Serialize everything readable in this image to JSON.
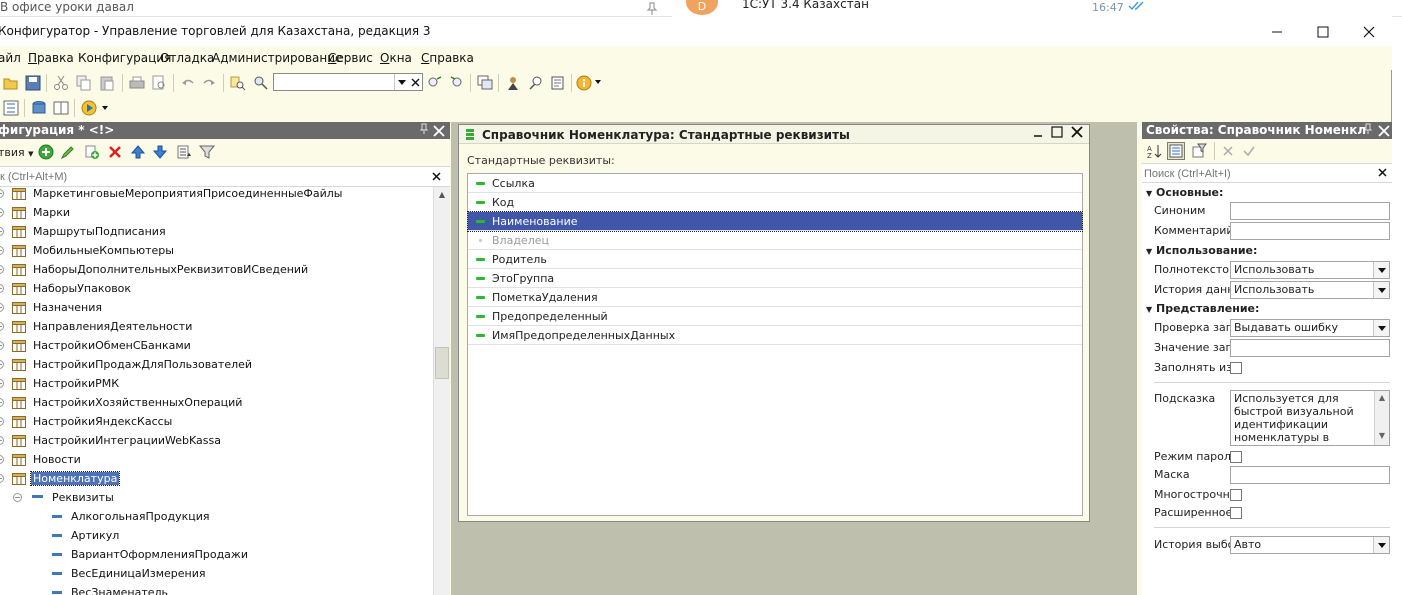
{
  "chat": {
    "title": "В офисе уроки давал",
    "avatar_letter": "D",
    "notification_text": "1С:УТ 3.4 Казахстан",
    "time": "16:47"
  },
  "window": {
    "title": "Конфигуратор - Управление торговлей для Казахстана, редакция 3"
  },
  "menu": [
    {
      "label": "айл"
    },
    {
      "label": "Правка",
      "underline": "П",
      "rest": "равка"
    },
    {
      "label": "Конфигурация"
    },
    {
      "label": "Отладка"
    },
    {
      "label": "Администрирование"
    },
    {
      "label": "Сервис",
      "underline": "С",
      "rest": "ервис"
    },
    {
      "label": "Окна",
      "underline": "О",
      "rest": "кна"
    },
    {
      "label": "Справка",
      "underline": "С",
      "rest": "правка"
    }
  ],
  "toolbar": {
    "search_value": ""
  },
  "config_panel": {
    "title": "фигурация * <!>",
    "actions_label": "твия",
    "search_placeholder": "к (Ctrl+Alt+M)",
    "tree": [
      {
        "label": "МаркетинговыеМероприятияПрисоединенныеФайлы",
        "level": 0
      },
      {
        "label": "Марки",
        "level": 0
      },
      {
        "label": "МаршрутыПодписания",
        "level": 0
      },
      {
        "label": "МобильныеКомпьютеры",
        "level": 0
      },
      {
        "label": "НаборыДополнительныхРеквизитовИСведений",
        "level": 0
      },
      {
        "label": "НаборыУпаковок",
        "level": 0
      },
      {
        "label": "Назначения",
        "level": 0
      },
      {
        "label": "НаправленияДеятельности",
        "level": 0
      },
      {
        "label": "НастройкиОбменСБанками",
        "level": 0
      },
      {
        "label": "НастройкиПродажДляПользователей",
        "level": 0
      },
      {
        "label": "НастройкиРМК",
        "level": 0
      },
      {
        "label": "НастройкиХозяйственныхОпераций",
        "level": 0
      },
      {
        "label": "НастройкиЯндексКассы",
        "level": 0
      },
      {
        "label": "НастройкиИнтеграцииWebKassa",
        "level": 0
      },
      {
        "label": "Новости",
        "level": 0
      },
      {
        "label": "Номенклатура",
        "level": 0,
        "selected": true
      },
      {
        "label": "Реквизиты",
        "level": 1
      },
      {
        "label": "АлкогольнаяПродукция",
        "level": 2
      },
      {
        "label": "Артикул",
        "level": 2
      },
      {
        "label": "ВариантОформленияПродажи",
        "level": 2
      },
      {
        "label": "ВесЕдиницаИзмерения",
        "level": 2
      },
      {
        "label": "ВесЗнаменатель",
        "level": 2
      }
    ]
  },
  "dialog": {
    "title": "Справочник Номенклатура: Стандартные реквизиты",
    "label": "Стандартные реквизиты:",
    "items": [
      {
        "label": "Ссылка"
      },
      {
        "label": "Код"
      },
      {
        "label": "Наименование",
        "selected": true
      },
      {
        "label": "Владелец",
        "disabled": true
      },
      {
        "label": "Родитель"
      },
      {
        "label": "ЭтоГруппа"
      },
      {
        "label": "ПометкаУдаления"
      },
      {
        "label": "Предопределенный"
      },
      {
        "label": "ИмяПредопределенныхДанных"
      }
    ]
  },
  "properties": {
    "title": "Свойства: Справочник Номенкла...",
    "search_placeholder": "Поиск (Ctrl+Alt+I)",
    "sections": {
      "basic": "Основные:",
      "usage": "Использование:",
      "presentation": "Представление:"
    },
    "synonym_label": "Синоним",
    "synonym_value": "",
    "comment_label": "Комментарий",
    "comment_value": "",
    "fulltext_label": "Полнотекстовый поиск",
    "fulltext_value": "Использовать",
    "history_label": "История данных",
    "history_value": "Использовать",
    "fillcheck_label": "Проверка заполнения",
    "fillcheck_value": "Выдавать ошибку",
    "fillvalue_label": "Значение заполнения",
    "fillvalue_value": "",
    "fillfrom_label": "Заполнять из данных заполнения",
    "tooltip_label": "Подсказка",
    "tooltip_value": "Используется для быстрой визуальной идентификации номенклатуры в",
    "password_label": "Режим пароля",
    "mask_label": "Маска",
    "mask_value": "",
    "multiline_label": "Многострочный режим",
    "extended_label": "Расширенное редактирование",
    "choice_history_label": "История выбора при вводе",
    "choice_history_value": "Авто"
  }
}
